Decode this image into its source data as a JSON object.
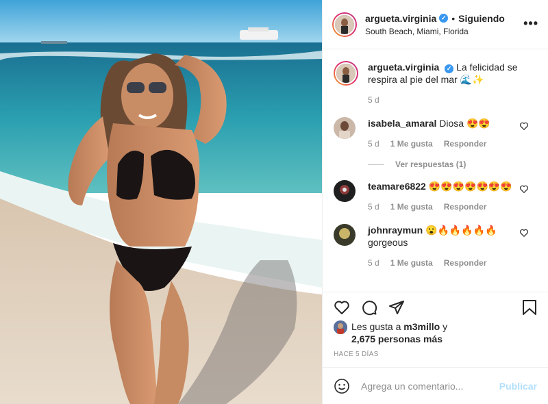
{
  "post": {
    "username": "argueta.virginia",
    "follow_label": "Siguiendo",
    "location": "South Beach, Miami, Florida",
    "more_icon": "more-options-icon",
    "photo_alt": "Photo"
  },
  "caption": {
    "username": "argueta.virginia",
    "text": "La felicidad se respira al pie del mar 🌊✨",
    "time": "5 d"
  },
  "comments": [
    {
      "username": "isabela_amaral",
      "text": "Diosa 😍😍",
      "time": "5 d",
      "likes": "1 Me gusta",
      "reply": "Responder",
      "view_replies": "Ver respuestas (1)"
    },
    {
      "username": "teamare6822",
      "text": "😍😍😍😍😍😍😍",
      "time": "5 d",
      "likes": "1 Me gusta",
      "reply": "Responder"
    },
    {
      "username": "johnraymun",
      "text": "😮🔥🔥🔥🔥🔥 gorgeous",
      "time": "5 d",
      "likes": "1 Me gusta",
      "reply": "Responder"
    }
  ],
  "likes": {
    "prefix": "Les gusta a",
    "user": "m3millo",
    "conj": "y",
    "others": "2,675 personas más"
  },
  "timestamp": "HACE 5 DÍAS",
  "add_comment": {
    "placeholder": "Agrega un comentario...",
    "publish_label": "Publicar"
  },
  "colors": {
    "verified": "#3897f0",
    "publish_disabled": "#b2dffc",
    "muted": "#8e8e8e"
  }
}
